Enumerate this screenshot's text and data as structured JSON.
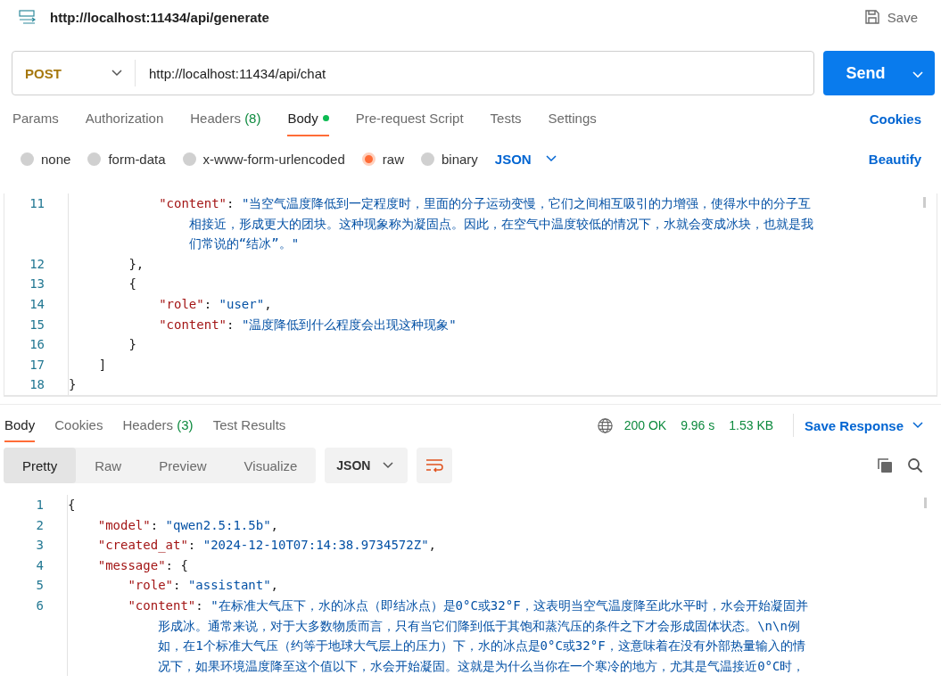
{
  "header": {
    "title": "http://localhost:11434/api/generate",
    "save_label": "Save"
  },
  "request": {
    "method": "POST",
    "url": "http://localhost:11434/api/chat",
    "send_label": "Send"
  },
  "request_tabs": [
    {
      "label": "Params",
      "selected": false,
      "has_content": false
    },
    {
      "label": "Authorization",
      "selected": false,
      "has_content": false
    },
    {
      "label": "Headers",
      "count": "(8)",
      "selected": false,
      "has_content": false
    },
    {
      "label": "Body",
      "selected": true,
      "has_content": true
    },
    {
      "label": "Pre-request Script",
      "selected": false,
      "has_content": false
    },
    {
      "label": "Tests",
      "selected": false,
      "has_content": false
    },
    {
      "label": "Settings",
      "selected": false,
      "has_content": false
    }
  ],
  "cookies_link": "Cookies",
  "body_types": [
    {
      "label": "none",
      "selected": false
    },
    {
      "label": "form-data",
      "selected": false
    },
    {
      "label": "x-www-form-urlencoded",
      "selected": false
    },
    {
      "label": "raw",
      "selected": true
    },
    {
      "label": "binary",
      "selected": false
    }
  ],
  "body_format": "JSON",
  "beautify_link": "Beautify",
  "request_body": [
    {
      "number": "11",
      "tokens": [
        {
          "kind": "key",
          "text": "            \"content\""
        },
        {
          "kind": "punct",
          "text": ": "
        },
        {
          "kind": "string",
          "parts": [
            "\"当空气温度降低到一定程度时，里面的分子运动变慢，它们之间相互吸引的力增强，使得水中的分子互",
            "相接近，形成更大的团块。这种现象称为凝固点。因此，在空气中温度较低的情况下，水就会变成冰块，也就是我",
            "们常说的“结冰”。\""
          ]
        }
      ]
    },
    {
      "number": "12",
      "tokens": [
        {
          "kind": "punct",
          "text": "        },"
        }
      ]
    },
    {
      "number": "13",
      "tokens": [
        {
          "kind": "punct",
          "text": "        {"
        }
      ]
    },
    {
      "number": "14",
      "tokens": [
        {
          "kind": "key",
          "text": "            \"role\""
        },
        {
          "kind": "punct",
          "text": ": "
        },
        {
          "kind": "string",
          "parts": [
            "\"user\""
          ]
        },
        {
          "kind": "punct",
          "text": ","
        }
      ]
    },
    {
      "number": "15",
      "tokens": [
        {
          "kind": "key",
          "text": "            \"content\""
        },
        {
          "kind": "punct",
          "text": ": "
        },
        {
          "kind": "string",
          "parts": [
            "\"温度降低到什么程度会出现这种现象\""
          ]
        }
      ]
    },
    {
      "number": "16",
      "tokens": [
        {
          "kind": "punct",
          "text": "        }"
        }
      ]
    },
    {
      "number": "17",
      "tokens": [
        {
          "kind": "punct",
          "text": "    ]"
        }
      ]
    },
    {
      "number": "18",
      "tokens": [
        {
          "kind": "punct",
          "text": "}"
        }
      ]
    }
  ],
  "response_tabs": [
    {
      "label": "Body",
      "selected": true
    },
    {
      "label": "Cookies",
      "selected": false
    },
    {
      "label": "Headers",
      "count": "(3)",
      "selected": false
    },
    {
      "label": "Test Results",
      "selected": false
    }
  ],
  "response_status": {
    "status": "200 OK",
    "time": "9.96 s",
    "size": "1.53 KB",
    "save_label": "Save Response"
  },
  "view_modes": [
    {
      "label": "Pretty",
      "selected": true
    },
    {
      "label": "Raw",
      "selected": false
    },
    {
      "label": "Preview",
      "selected": false
    },
    {
      "label": "Visualize",
      "selected": false
    }
  ],
  "response_format": "JSON",
  "response_body": [
    {
      "number": "1",
      "tokens": [
        {
          "kind": "punct",
          "text": "{"
        }
      ]
    },
    {
      "number": "2",
      "tokens": [
        {
          "kind": "key",
          "text": "    \"model\""
        },
        {
          "kind": "punct",
          "text": ": "
        },
        {
          "kind": "string",
          "parts": [
            "\"qwen2.5:1.5b\""
          ]
        },
        {
          "kind": "punct",
          "text": ","
        }
      ]
    },
    {
      "number": "3",
      "tokens": [
        {
          "kind": "key",
          "text": "    \"created_at\""
        },
        {
          "kind": "punct",
          "text": ": "
        },
        {
          "kind": "string",
          "parts": [
            "\"2024-12-10T07:14:38.9734572Z\""
          ]
        },
        {
          "kind": "punct",
          "text": ","
        }
      ]
    },
    {
      "number": "4",
      "tokens": [
        {
          "kind": "key",
          "text": "    \"message\""
        },
        {
          "kind": "punct",
          "text": ": {"
        }
      ]
    },
    {
      "number": "5",
      "tokens": [
        {
          "kind": "key",
          "text": "        \"role\""
        },
        {
          "kind": "punct",
          "text": ": "
        },
        {
          "kind": "string",
          "parts": [
            "\"assistant\""
          ]
        },
        {
          "kind": "punct",
          "text": ","
        }
      ]
    },
    {
      "number": "6",
      "tokens": [
        {
          "kind": "key",
          "text": "        \"content\""
        },
        {
          "kind": "punct",
          "text": ": "
        },
        {
          "kind": "string",
          "parts": [
            "\"在标准大气压下，水的冰点（即结冰点）是0°C或32°F，这表明当空气温度降至此水平时，水会开始凝固并",
            "形成冰。通常来说，对于大多数物质而言，只有当它们降到低于其饱和蒸汽压的条件之下才会形成固体状态。\\n\\n例",
            "如，在1个标准大气压（约等于地球大气层上的压力）下，水的冰点是0°C或32°F，这意味着在没有外部热量输入的情",
            "况下，如果环境温度降至这个值以下，水会开始凝固。这就是为什么当你在一个寒冷的地方，尤其是气温接近0°C时，"
          ]
        }
      ]
    }
  ]
}
